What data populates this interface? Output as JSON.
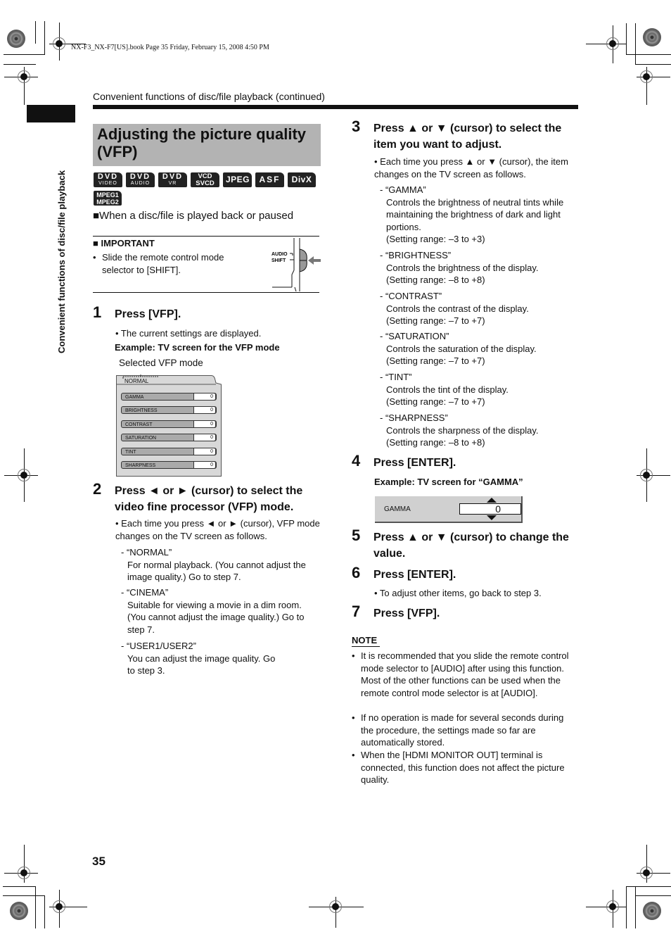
{
  "book_info": "NX-F3_NX-F7[US].book  Page 35  Friday, February 15, 2008  4:50 PM",
  "running_head": "Convenient functions of disc/file playback (continued)",
  "side_tab": "Convenient functions of disc/file playback",
  "section_title": "Adjusting the picture quality (VFP)",
  "badges": [
    {
      "top": "DVD",
      "bottom": "VIDEO"
    },
    {
      "top": "DVD",
      "bottom": "AUDIO"
    },
    {
      "top": "DVD",
      "bottom": "VR"
    },
    {
      "top": "VCD",
      "bottom": "SVCD"
    },
    {
      "label": "JPEG"
    },
    {
      "label": "ASF"
    },
    {
      "label": "DivX"
    },
    {
      "top": "MPEG1",
      "bottom": "MPEG2"
    }
  ],
  "condition": "■When a disc/file is played back or paused",
  "important": {
    "title": "■ IMPORTANT",
    "text": "Slide the remote control mode selector to [SHIFT].",
    "switch_labels": {
      "audio": "AUDIO",
      "shift": "SHIFT"
    }
  },
  "steps": [
    {
      "num": "1",
      "title": "Press [VFP].",
      "bullet": "• The current settings are displayed.",
      "example": "Example: TV screen for the VFP mode",
      "callout": "Selected VFP mode"
    },
    {
      "num": "2",
      "title": "Press ◄ or ► (cursor) to select the video fine processor (VFP) mode.",
      "bullet": "• Each time you press ◄ or ► (cursor), VFP mode changes on the TV screen as follows.",
      "items": [
        {
          "name": "- “NORMAL”",
          "desc": "For normal playback. (You cannot adjust the image quality.) Go to step 7."
        },
        {
          "name": "- “CINEMA”",
          "desc": "Suitable for viewing a movie in a dim room. (You cannot adjust the image quality.) Go to step 7."
        },
        {
          "name": "- “USER1/USER2”",
          "desc": "You can adjust the image quality. Go to step 3."
        }
      ]
    },
    {
      "num": "3",
      "title": "Press ▲ or ▼ (cursor) to select the item you want to adjust.",
      "bullet": "• Each time you press ▲ or ▼ (cursor), the item changes on the TV screen as follows.",
      "items": [
        {
          "name": "- “GAMMA”",
          "desc": "Controls the brightness of neutral tints while maintaining the brightness of dark and light portions.",
          "range": "(Setting range: –3 to +3)"
        },
        {
          "name": "- “BRIGHTNESS”",
          "desc": "Controls the brightness of the display.",
          "range": "(Setting range: –8 to +8)"
        },
        {
          "name": "- “CONTRAST”",
          "desc": "Controls the contrast of the display.",
          "range": "(Setting range: –7 to +7)"
        },
        {
          "name": "- “SATURATION”",
          "desc": "Controls the saturation of the display.",
          "range": "(Setting range: –7 to +7)"
        },
        {
          "name": "- “TINT”",
          "desc": "Controls the tint of the display.",
          "range": "(Setting range: –7 to +7)"
        },
        {
          "name": "- “SHARPNESS”",
          "desc": "Controls the sharpness of the display.",
          "range": "(Setting range: –8 to +8)"
        }
      ]
    },
    {
      "num": "4",
      "title": "Press [ENTER].",
      "example": "Example: TV screen for “GAMMA”"
    },
    {
      "num": "5",
      "title": "Press ▲ or ▼ (cursor) to change the value."
    },
    {
      "num": "6",
      "title": "Press [ENTER].",
      "bullet": "• To adjust other items, go back to step 3."
    },
    {
      "num": "7",
      "title": "Press [VFP]."
    }
  ],
  "tv_vfp": {
    "mode": "NORMAL",
    "rows": [
      {
        "label": "GAMMA",
        "value": "0"
      },
      {
        "label": "BRIGHTNESS",
        "value": "0"
      },
      {
        "label": "CONTRAST",
        "value": "0"
      },
      {
        "label": "SATURATION",
        "value": "0"
      },
      {
        "label": "TINT",
        "value": "0"
      },
      {
        "label": "SHARPNESS",
        "value": "0"
      }
    ]
  },
  "tv_gamma": {
    "label": "GAMMA",
    "value": "0"
  },
  "note": {
    "title": "NOTE",
    "items": [
      "It is recommended that you slide the remote control mode selector to [AUDIO] after using this function. Most of the other functions can be used when the remote control mode selector is at [AUDIO].",
      "If no operation is made for several seconds during the procedure, the settings made so far are automatically stored.",
      "When the [HDMI MONITOR OUT] terminal is connected, this function does not affect the picture quality."
    ]
  },
  "page_number": "35"
}
